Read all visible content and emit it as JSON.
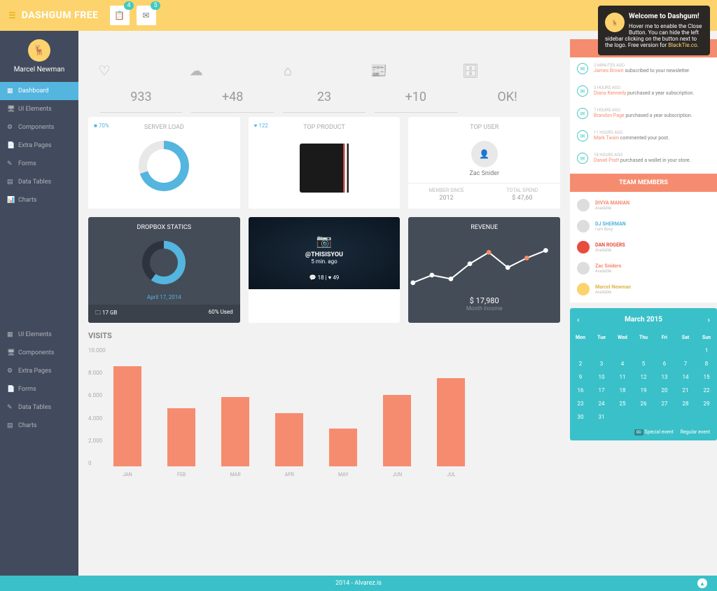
{
  "header": {
    "brand": "DASHGUM FREE",
    "badge1": "4",
    "badge2": "5"
  },
  "notify": {
    "title": "Welcome to Dashgum!",
    "body": "Hover me to enable the Close Button. You can hide the left sidebar clicking on the button next to the logo. Free version for ",
    "link": "BlackTie.co"
  },
  "profile": {
    "name": "Marcel Newman"
  },
  "nav": [
    {
      "label": "Dashboard",
      "active": true
    },
    {
      "label": "UI Elements"
    },
    {
      "label": "Components"
    },
    {
      "label": "Extra Pages"
    },
    {
      "label": "Forms"
    },
    {
      "label": "Data Tables"
    },
    {
      "label": "Charts"
    }
  ],
  "nav2": [
    {
      "label": "UI Elements"
    },
    {
      "label": "Components"
    },
    {
      "label": "Extra Pages"
    },
    {
      "label": "Forms"
    },
    {
      "label": "Data Tables"
    },
    {
      "label": "Charts"
    }
  ],
  "stats": [
    {
      "val": "933"
    },
    {
      "val": "+48"
    },
    {
      "val": "23"
    },
    {
      "val": "+10"
    },
    {
      "val": "OK!"
    }
  ],
  "serverLoad": {
    "title": "SERVER LOAD",
    "pct": "70%"
  },
  "topProduct": {
    "title": "TOP PRODUCT",
    "likes": "122"
  },
  "topUser": {
    "title": "TOP USER",
    "name": "Zac Snider",
    "sinceLabel": "MEMBER SINCE",
    "since": "2012",
    "spendLabel": "TOTAL SPEND",
    "spend": "$ 47,60"
  },
  "dropbox": {
    "title": "DROPBOX STATICS",
    "date": "April 17, 2014",
    "size": "17 GB",
    "used": "60% Used"
  },
  "insta": {
    "handle": "@THISISYOU",
    "time": "5 min. ago",
    "chat": "18",
    "heart": "49"
  },
  "revenue": {
    "title": "REVENUE",
    "val": "$ 17,980",
    "label": "Month Income"
  },
  "visits": {
    "title": "VISITS"
  },
  "chart_data": {
    "type": "bar",
    "categories": [
      "JAN",
      "FEB",
      "MAR",
      "APR",
      "MAY",
      "JUN",
      "JUL"
    ],
    "values": [
      8400,
      4900,
      5800,
      4500,
      3200,
      6000,
      7400
    ],
    "ylim": [
      0,
      10000
    ],
    "yticks": [
      "0",
      "2.000",
      "4.000",
      "6.000",
      "8.000",
      "10.000"
    ],
    "title": "VISITS",
    "xlabel": "",
    "ylabel": ""
  },
  "notifications": [
    {
      "time": "2 MINUTES AGO",
      "who": "James Brown",
      "txt": " subscribed to your newsletter."
    },
    {
      "time": "3 HOURS AGO",
      "who": "Diana Kennedy",
      "txt": " purchased a year subscription."
    },
    {
      "time": "7 HOURS AGO",
      "who": "Brandon Page",
      "txt": " purchased a year subscription."
    },
    {
      "time": "11 HOURS AGO",
      "who": "Mark Twain",
      "txt": " commented your post."
    },
    {
      "time": "18 HOURS AGO",
      "who": "Daniel Pratt",
      "txt": " purchased a wallet in your store."
    }
  ],
  "teamTitle": "TEAM MEMBERS",
  "team": [
    {
      "name": "DIVYA MANIAN",
      "status": "Available",
      "cls": "o"
    },
    {
      "name": "DJ SHERMAN",
      "status": "I am Busy",
      "cls": "b"
    },
    {
      "name": "DAN ROGERS",
      "status": "Available",
      "cls": "r",
      "av": "r"
    },
    {
      "name": "Zac Sniders",
      "status": "Available",
      "cls": "o"
    },
    {
      "name": "Marcel Newman",
      "status": "Available",
      "cls": "y",
      "av": "y"
    }
  ],
  "calendar": {
    "month": "March 2015",
    "dow": [
      "Mon",
      "Tue",
      "Wed",
      "Thu",
      "Fri",
      "Sat",
      "Sun"
    ],
    "startOffset": 6,
    "days": 31,
    "special": "Special event",
    "regular": "Regular event",
    "sp": "00"
  },
  "footer": "2014 - Alvarez.is"
}
